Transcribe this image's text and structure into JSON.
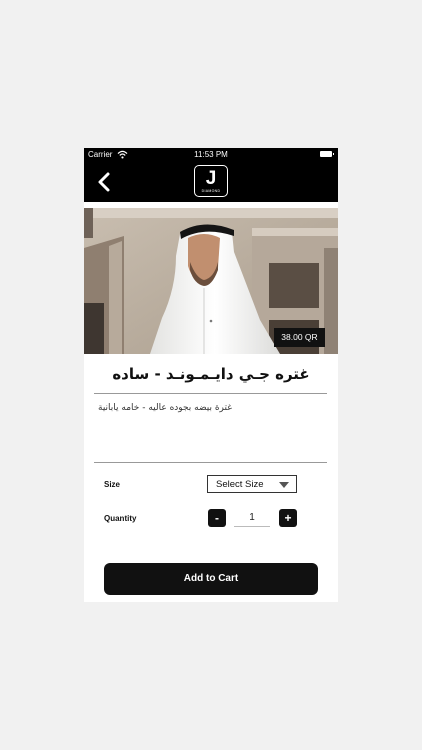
{
  "status_bar": {
    "carrier": "Carrier",
    "time": "11:53 PM"
  },
  "nav": {
    "logo_mark": "J",
    "logo_sub": "DIAMOND"
  },
  "product": {
    "price": "38.00 QR",
    "title": "غتره جـي دايـمـونـد - ساده",
    "description": "غترة بيضه بجوده عاليه - خامه يابانية"
  },
  "options": {
    "size_label": "Size",
    "size_select": "Select Size",
    "quantity_label": "Quantity",
    "minus": "-",
    "plus": "+",
    "quantity_value": "1"
  },
  "cart": {
    "button_label": "Add to Cart"
  },
  "colors": {
    "primary": "#111111",
    "background": "#f1f1f1"
  },
  "icons": [
    "wifi-icon",
    "battery-icon",
    "back-chevron-icon",
    "caret-down-icon"
  ]
}
